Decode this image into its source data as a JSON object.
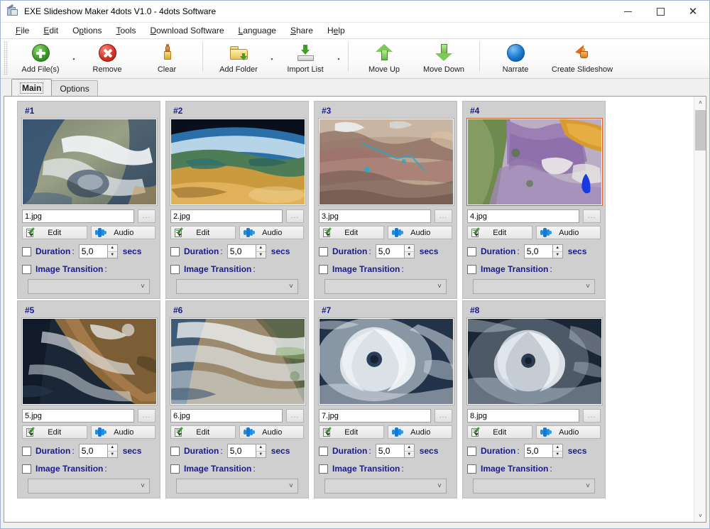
{
  "window": {
    "title": "EXE Slideshow Maker 4dots V1.0 - 4dots Software",
    "app_icon": "app-slideshow-icon",
    "minimize": "–",
    "maximize": "□",
    "close": "✕"
  },
  "menu": {
    "items": [
      {
        "label": "File",
        "accel": "F"
      },
      {
        "label": "Edit",
        "accel": "E"
      },
      {
        "label": "Options",
        "accel": "O"
      },
      {
        "label": "Tools",
        "accel": "T"
      },
      {
        "label": "Download Software",
        "accel": "D"
      },
      {
        "label": "Language",
        "accel": "L"
      },
      {
        "label": "Share",
        "accel": "S"
      },
      {
        "label": "Help",
        "accel": "H"
      }
    ]
  },
  "toolbar": {
    "items": [
      {
        "label": "Add File(s)",
        "icon": "add-file-icon",
        "dropdown": true
      },
      {
        "label": "Remove",
        "icon": "remove-icon",
        "dropdown": false
      },
      {
        "label": "Clear",
        "icon": "clear-brush-icon",
        "dropdown": false
      },
      {
        "label": "Add Folder",
        "icon": "add-folder-icon",
        "dropdown": true
      },
      {
        "label": "Import List",
        "icon": "import-list-icon",
        "dropdown": true
      },
      {
        "label": "Move Up",
        "icon": "arrow-up-icon",
        "dropdown": false
      },
      {
        "label": "Move Down",
        "icon": "arrow-down-icon",
        "dropdown": false
      },
      {
        "label": "Narrate",
        "icon": "narrate-icon",
        "dropdown": false
      },
      {
        "label": "Create Slideshow",
        "icon": "create-slideshow-icon",
        "dropdown": false
      }
    ],
    "dropdown_marker": "▪"
  },
  "tabs": [
    {
      "label": "Main",
      "active": true
    },
    {
      "label": "Options",
      "active": false
    }
  ],
  "labels": {
    "edit": "Edit",
    "audio": "Audio",
    "duration": "Duration",
    "colon": ":",
    "secs": "secs",
    "image_transition": "Image Transition",
    "ellipsis": "...",
    "transition_value": "",
    "chevron": "˅"
  },
  "cards": [
    {
      "title": "#1",
      "filename": "1.jpg",
      "duration": "5,0",
      "duration_checked": false,
      "transition_checked": false,
      "selected": false,
      "thumb": "storm-clouds-ocean"
    },
    {
      "title": "#2",
      "filename": "2.jpg",
      "duration": "5,0",
      "duration_checked": false,
      "transition_checked": false,
      "selected": false,
      "thumb": "earth-limb-desert"
    },
    {
      "title": "#3",
      "filename": "3.jpg",
      "duration": "5,0",
      "duration_checked": false,
      "transition_checked": false,
      "selected": false,
      "thumb": "satellite-terrain-pink"
    },
    {
      "title": "#4",
      "filename": "4.jpg",
      "duration": "5,0",
      "duration_checked": false,
      "transition_checked": false,
      "selected": true,
      "thumb": "satellite-terrain-purple"
    },
    {
      "title": "#5",
      "filename": "5.jpg",
      "duration": "5,0",
      "duration_checked": false,
      "transition_checked": false,
      "selected": false,
      "thumb": "wildfire-smoke-coast"
    },
    {
      "title": "#6",
      "filename": "6.jpg",
      "duration": "5,0",
      "duration_checked": false,
      "transition_checked": false,
      "selected": false,
      "thumb": "dust-storm-coast"
    },
    {
      "title": "#7",
      "filename": "7.jpg",
      "duration": "5,0",
      "duration_checked": false,
      "transition_checked": false,
      "selected": false,
      "thumb": "hurricane-eye-blue"
    },
    {
      "title": "#8",
      "filename": "8.jpg",
      "duration": "5,0",
      "duration_checked": false,
      "transition_checked": false,
      "selected": false,
      "thumb": "hurricane-eye-gray"
    }
  ],
  "scrollbar": {
    "up_arrow": "˄",
    "down_arrow": "˅"
  },
  "colors": {
    "label_blue": "#1a1a8c",
    "selection_orange": "#cf5a22",
    "card_bg": "#cfcfcf",
    "window_bg": "#f0f0f0"
  }
}
